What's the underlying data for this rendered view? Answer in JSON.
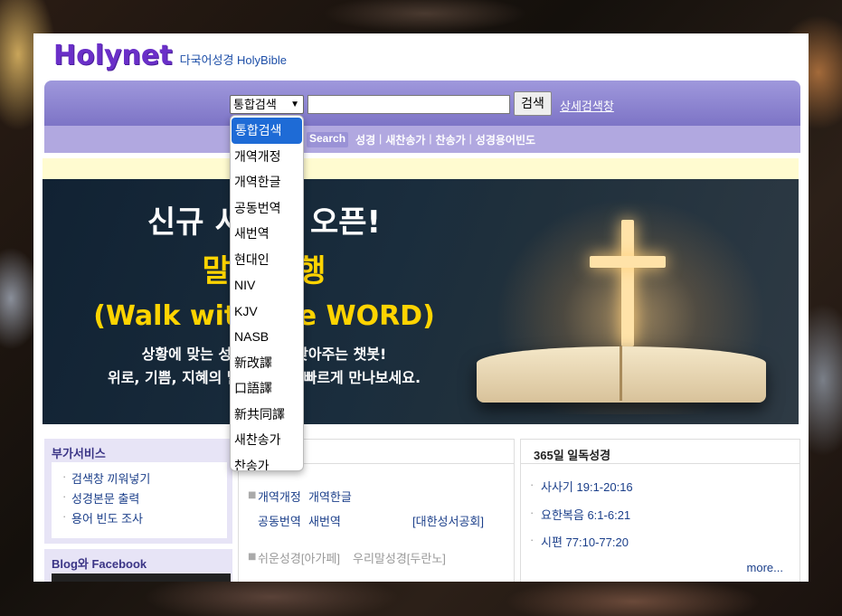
{
  "header": {
    "logo": "Holynet",
    "subtitle": "다국어성경 HolyBible"
  },
  "search": {
    "selected": "통합검색",
    "input_value": "",
    "button_label": "검색",
    "advanced_link": "상세검색창"
  },
  "nav": {
    "search_tag": "Search",
    "items": [
      "성경",
      "새찬송가",
      "찬송가",
      "성경용어빈도"
    ]
  },
  "banner": {
    "line1": "신규 서비스 오픈!",
    "line2": "말씀 동행",
    "line3": "(Walk with the WORD)",
    "line4": "상황에 맞는 성경 구절을 찾아주는 챗봇!",
    "line5": "위로, 기쁨, 지혜의 말씀을 쉽고 빠르게 만나보세요."
  },
  "dropdown": {
    "options": [
      "통합검색",
      "개역개정",
      "개역한글",
      "공동번역",
      "새번역",
      "현대인",
      "NIV",
      "KJV",
      "NASB",
      "新改譯",
      "口語譯",
      "新共同譯",
      "새찬송가",
      "찬송가"
    ],
    "selected_index": 0
  },
  "side": {
    "title": "부가서비스",
    "items": [
      "검색창 끼워넣기",
      "성경본문 출력",
      "용어 빈도 조사"
    ],
    "fb_title": "Blog와 Facebook"
  },
  "middle": {
    "row1": [
      "개역개정",
      "개역한글"
    ],
    "row2": [
      "공동번역",
      "새번역"
    ],
    "publisher": "[대한성서공회]",
    "row3": [
      "쉬운성경[아가페]",
      "우리말성경[두란노]"
    ]
  },
  "daily": {
    "title": "365일 일독성경",
    "items": [
      "사사기 19:1-20:16",
      "요한복음 6:1-6:21",
      "시편 77:10-77:20"
    ],
    "more": "more..."
  },
  "colors": {
    "brand": "#6a2fc8",
    "searchbar": "#8d85d1",
    "navbar": "#b1a8e0",
    "selected_option": "#1e6bd6",
    "banner_yellow": "#ffd400"
  }
}
